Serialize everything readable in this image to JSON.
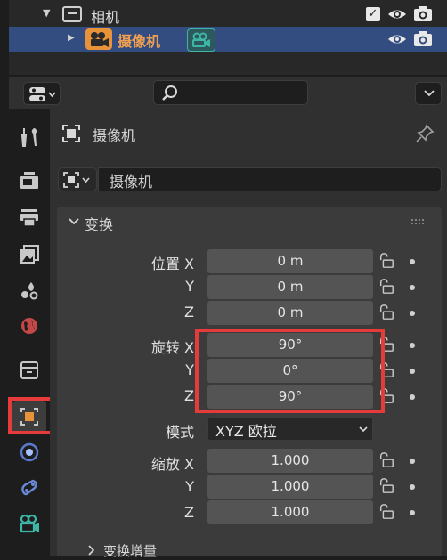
{
  "outliner": {
    "rows": [
      {
        "label": "相机",
        "checked": true
      },
      {
        "label": "摄像机",
        "selected": true
      }
    ]
  },
  "header": {
    "search_placeholder": ""
  },
  "panel": {
    "object_title": "摄像机",
    "object_name": "摄像机",
    "transform_section": "变换",
    "delta_section": "变换增量",
    "location": {
      "label": "位置",
      "axes": [
        "X",
        "Y",
        "Z"
      ],
      "values": [
        "0 m",
        "0 m",
        "0 m"
      ]
    },
    "rotation": {
      "label": "旋转",
      "axes": [
        "X",
        "Y",
        "Z"
      ],
      "values": [
        "90°",
        "0°",
        "90°"
      ]
    },
    "mode": {
      "label": "模式",
      "value": "XYZ 欧拉"
    },
    "scale": {
      "label": "缩放",
      "axes": [
        "X",
        "Y",
        "Z"
      ],
      "values": [
        "1.000",
        "1.000",
        "1.000"
      ]
    }
  },
  "colors": {
    "selection": "#334d80",
    "camera_orange": "#e8923a",
    "camera_teal": "#3fb5a8",
    "highlight_red": "#e63b3b",
    "field_bg": "#545454"
  },
  "icons": {
    "sidebar_tabs": [
      "tool-icon",
      "render-icon",
      "output-icon",
      "view-layer-icon",
      "scene-icon",
      "world-icon",
      "collection-icon",
      "object-icon",
      "modifier-icon",
      "physics-icon",
      "camera-data-icon"
    ]
  }
}
